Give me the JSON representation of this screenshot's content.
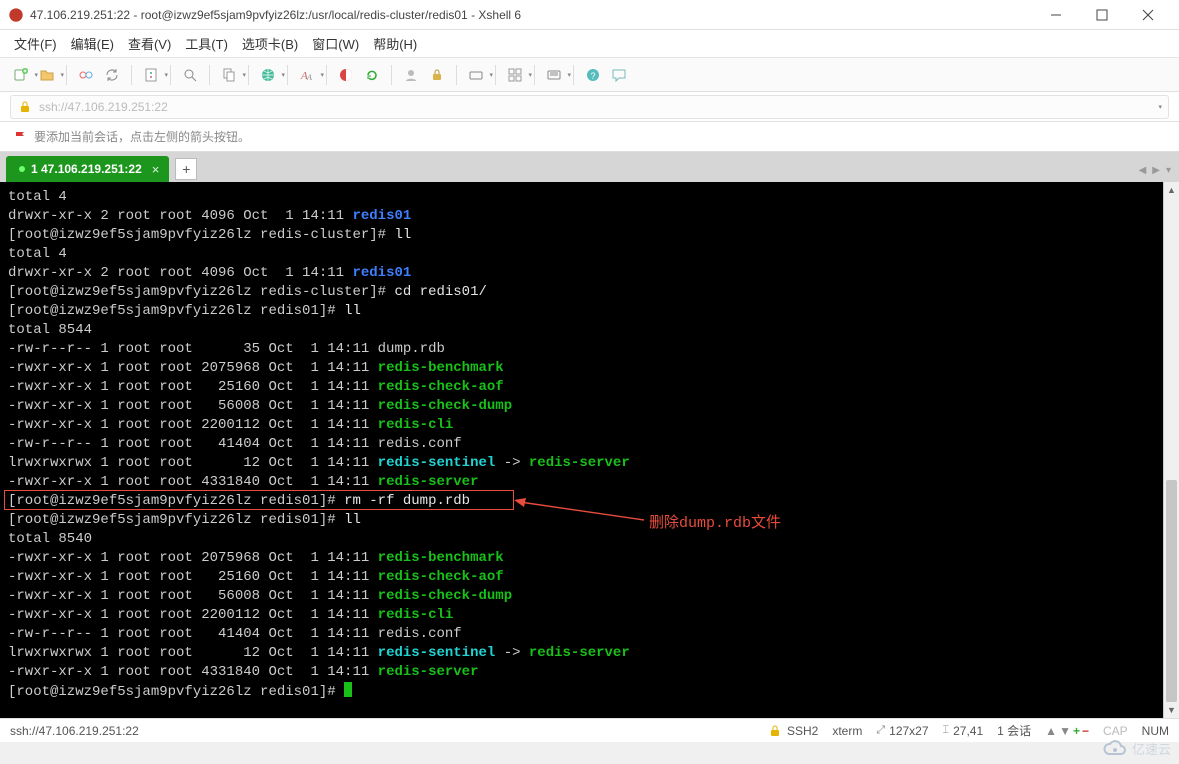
{
  "window": {
    "title": "47.106.219.251:22 - root@izwz9ef5sjam9pvfyiz26lz:/usr/local/redis-cluster/redis01 - Xshell 6"
  },
  "menu": {
    "file": "文件(F)",
    "edit": "编辑(E)",
    "view": "查看(V)",
    "tool": "工具(T)",
    "tabs": "选项卡(B)",
    "window": "窗口(W)",
    "help": "帮助(H)"
  },
  "address": {
    "text": "ssh://47.106.219.251:22"
  },
  "hint": {
    "text": "要添加当前会话，点击左侧的箭头按钮。"
  },
  "tab": {
    "label": "1 47.106.219.251:22"
  },
  "term": {
    "l1": "total 4",
    "l2a": "drwxr-xr-x 2 root root 4096 Oct  1 14:11 ",
    "l2b": "redis01",
    "l3a": "[root@izwz9ef5sjam9pvfyiz26lz redis-cluster]# ",
    "l3b": "ll",
    "l4": "total 4",
    "l5a": "drwxr-xr-x 2 root root 4096 Oct  1 14:11 ",
    "l5b": "redis01",
    "l6a": "[root@izwz9ef5sjam9pvfyiz26lz redis-cluster]# ",
    "l6b": "cd redis01/",
    "l7a": "[root@izwz9ef5sjam9pvfyiz26lz redis01]# ",
    "l7b": "ll",
    "l8": "total 8544",
    "l9": "-rw-r--r-- 1 root root      35 Oct  1 14:11 dump.rdb",
    "l10a": "-rwxr-xr-x 1 root root 2075968 Oct  1 14:11 ",
    "l10b": "redis-benchmark",
    "l11a": "-rwxr-xr-x 1 root root   25160 Oct  1 14:11 ",
    "l11b": "redis-check-aof",
    "l12a": "-rwxr-xr-x 1 root root   56008 Oct  1 14:11 ",
    "l12b": "redis-check-dump",
    "l13a": "-rwxr-xr-x 1 root root 2200112 Oct  1 14:11 ",
    "l13b": "redis-cli",
    "l14": "-rw-r--r-- 1 root root   41404 Oct  1 14:11 redis.conf",
    "l15a": "lrwxrwxrwx 1 root root      12 Oct  1 14:11 ",
    "l15b": "redis-sentinel",
    "l15c": " -> ",
    "l15d": "redis-server",
    "l16a": "-rwxr-xr-x 1 root root 4331840 Oct  1 14:11 ",
    "l16b": "redis-server",
    "l17a": "[root@izwz9ef5sjam9pvfyiz26lz redis01]# ",
    "l17b": "rm -rf dump.rdb",
    "l18a": "[root@izwz9ef5sjam9pvfyiz26lz redis01]# ",
    "l18b": "ll",
    "l19": "total 8540",
    "l20a": "-rwxr-xr-x 1 root root 2075968 Oct  1 14:11 ",
    "l20b": "redis-benchmark",
    "l21a": "-rwxr-xr-x 1 root root   25160 Oct  1 14:11 ",
    "l21b": "redis-check-aof",
    "l22a": "-rwxr-xr-x 1 root root   56008 Oct  1 14:11 ",
    "l22b": "redis-check-dump",
    "l23a": "-rwxr-xr-x 1 root root 2200112 Oct  1 14:11 ",
    "l23b": "redis-cli",
    "l24": "-rw-r--r-- 1 root root   41404 Oct  1 14:11 redis.conf",
    "l25a": "lrwxrwxrwx 1 root root      12 Oct  1 14:11 ",
    "l25b": "redis-sentinel",
    "l25c": " -> ",
    "l25d": "redis-server",
    "l26a": "-rwxr-xr-x 1 root root 4331840 Oct  1 14:11 ",
    "l26b": "redis-server",
    "l27": "[root@izwz9ef5sjam9pvfyiz26lz redis01]# "
  },
  "annot": {
    "text": "删除dump.rdb文件"
  },
  "status": {
    "left": "ssh://47.106.219.251:22",
    "conn": "SSH2",
    "term": "xterm",
    "size": "127x27",
    "pos": "27,41",
    "sess": "1 会话",
    "cap": "CAP",
    "num": "NUM"
  },
  "watermark": "亿速云"
}
